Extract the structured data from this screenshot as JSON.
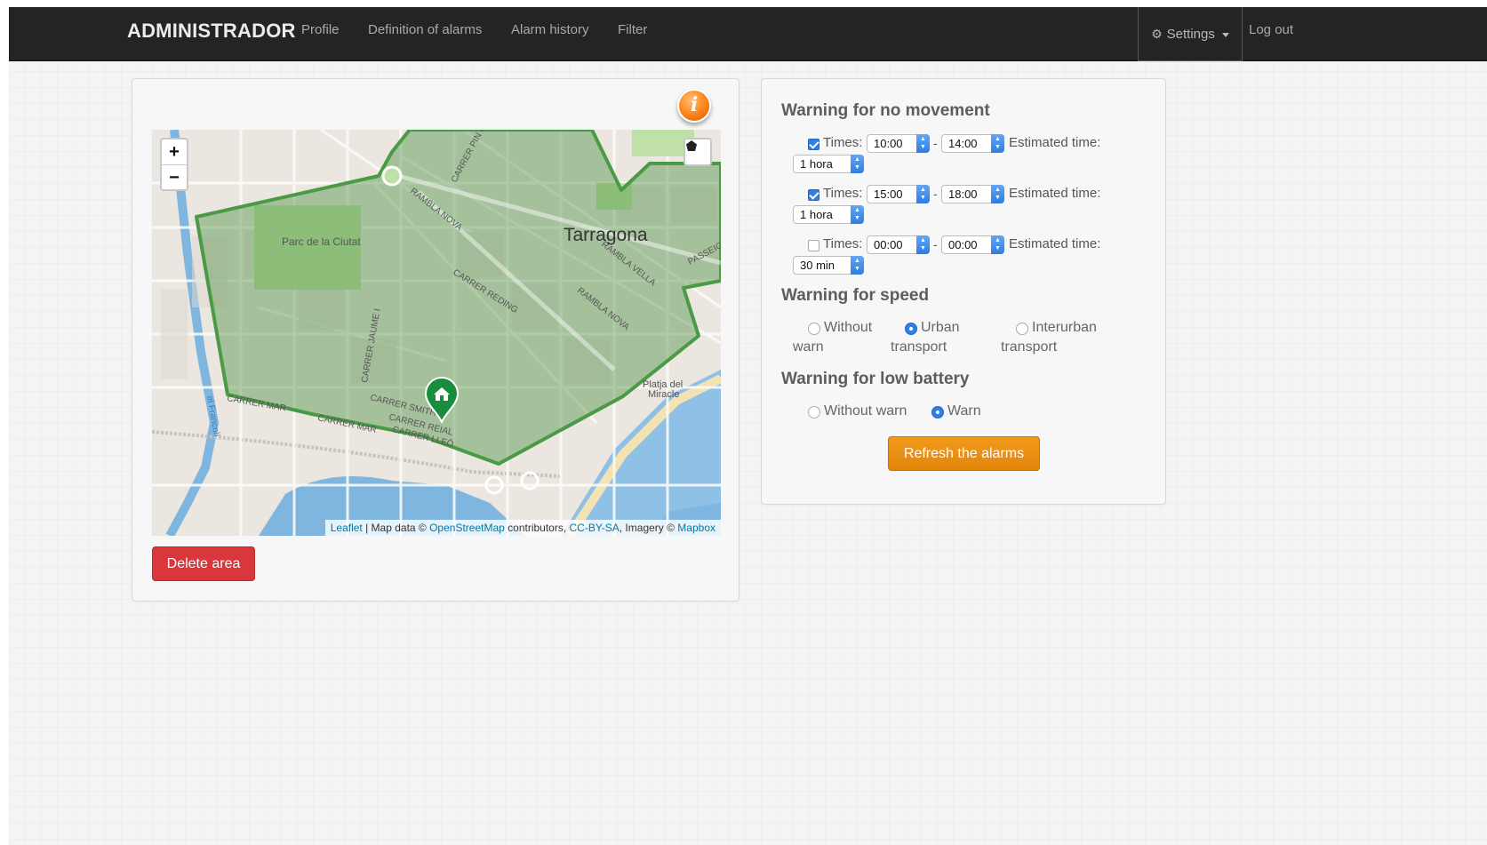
{
  "navbar": {
    "brand": "ADMINISTRADOR",
    "links": [
      "Profile",
      "Definition of alarms",
      "Alarm history",
      "Filter"
    ],
    "settings_label": "Settings",
    "logout_label": "Log out"
  },
  "map_panel": {
    "info_icon": "i",
    "zoom_in": "+",
    "zoom_out": "−",
    "labels": {
      "city": "Tarragona",
      "park": "Parc de la Ciutat",
      "beach_line1": "Platja del",
      "beach_line2": "Miracle",
      "streets": [
        "CARRER PIN I SOLER",
        "RAMBLA NOVA",
        "RAMBLA VELLA",
        "CARRER REDING",
        "RAMBLA NOVA",
        "CARRER JAUME I",
        "CARRER SMITH",
        "CARRER REIAL",
        "CARRER LLEÓ",
        "CARRER MAR",
        "CARRER MAR",
        "PASSEIG",
        "el Francolí"
      ]
    },
    "attribution": {
      "leaflet": "Leaflet",
      "text1": " | Map data © ",
      "osm": "OpenStreetMap",
      "text2": " contributors, ",
      "license": "CC-BY-SA",
      "text3": ", Imagery © ",
      "mapbox": "Mapbox"
    },
    "delete_label": "Delete area"
  },
  "alarms_panel": {
    "no_movement": {
      "title": "Warning for no movement",
      "rows": [
        {
          "checked": true,
          "label": "Times:",
          "from": "10:00",
          "to": "14:00",
          "estimated_label": "Estimated time:",
          "duration": "1 hora"
        },
        {
          "checked": true,
          "label": "Times:",
          "from": "15:00",
          "to": "18:00",
          "estimated_label": "Estimated time:",
          "duration": "1 hora"
        },
        {
          "checked": false,
          "label": "Times:",
          "from": "00:00",
          "to": "00:00",
          "estimated_label": "Estimated time:",
          "duration": "30 min"
        }
      ],
      "separator": "-"
    },
    "speed": {
      "title": "Warning for speed",
      "options": [
        {
          "line1": "Without",
          "line2": "warn",
          "selected": false
        },
        {
          "line1": "Urban",
          "line2": "transport",
          "selected": true
        },
        {
          "line1": "Interurban",
          "line2": "transport",
          "selected": false
        }
      ]
    },
    "battery": {
      "title": "Warning for low battery",
      "options": [
        {
          "label": "Without warn",
          "selected": false
        },
        {
          "label": "Warn",
          "selected": true
        }
      ]
    },
    "refresh_label": "Refresh the alarms"
  },
  "colors": {
    "navbar": "#242424",
    "delete": "#d9373b",
    "refresh": "#e88d12",
    "area": "#3f9a3a",
    "water": "#7fb6e0",
    "checkbox": "#2f7fe5"
  },
  "icons": [
    "gear-icon",
    "caret-down-icon",
    "info-icon",
    "polygon-draw-icon",
    "home-marker-icon",
    "spinner-arrows-icon"
  ]
}
